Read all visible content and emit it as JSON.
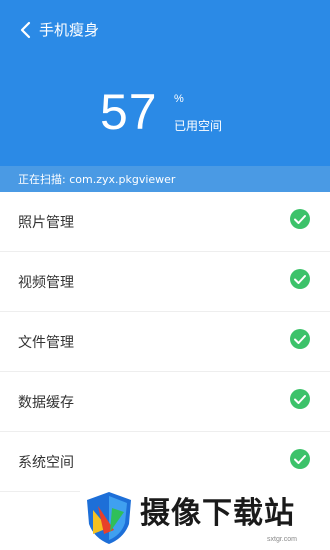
{
  "header": {
    "title": "手机瘦身",
    "usage_percent": "57",
    "percent_sign": "%",
    "usage_label": "已用空间",
    "scan_text": "正在扫描: com.zyx.pkgviewer"
  },
  "list": {
    "items": [
      {
        "label": "照片管理",
        "status": "done"
      },
      {
        "label": "视频管理",
        "status": "done"
      },
      {
        "label": "文件管理",
        "status": "done"
      },
      {
        "label": "数据缓存",
        "status": "done"
      },
      {
        "label": "系统空间",
        "status": "done"
      }
    ]
  },
  "watermark": {
    "text": "摄像下载站",
    "url": "sxtgr.com"
  },
  "colors": {
    "header_bg": "#2b8ae6",
    "scan_bar_bg": "#4a9ae4",
    "check_green": "#3cc26a"
  },
  "icons": {
    "back": "chevron-left-icon",
    "check": "check-circle-icon"
  }
}
